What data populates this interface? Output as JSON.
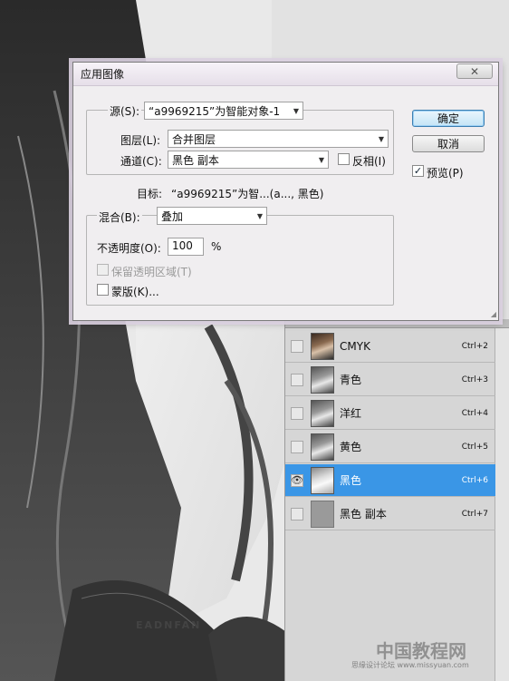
{
  "dialog": {
    "title": "应用图像",
    "source_label": "源(S):",
    "source_value": "“a9969215”为智能对象-1",
    "layer_label": "图层(L):",
    "layer_value": "合并图层",
    "channel_label": "通道(C):",
    "channel_value": "黑色 副本",
    "invert_label": "反相(I)",
    "target_label": "目标:",
    "target_value": "“a9969215”为智...(a..., 黑色)",
    "blending_label": "混合(B):",
    "blending_value": "叠加",
    "opacity_label": "不透明度(O):",
    "opacity_value": "100",
    "opacity_unit": "%",
    "preserve_transparency_label": "保留透明区域(T)",
    "mask_label": "蒙版(K)...",
    "ok_label": "确定",
    "cancel_label": "取消",
    "preview_label": "预览(P)",
    "close_glyph": "✕"
  },
  "channels_panel": {
    "channels": [
      {
        "name": "CMYK",
        "shortcut": "Ctrl+2",
        "visible": false
      },
      {
        "name": "青色",
        "shortcut": "Ctrl+3",
        "visible": false
      },
      {
        "name": "洋红",
        "shortcut": "Ctrl+4",
        "visible": false
      },
      {
        "name": "黄色",
        "shortcut": "Ctrl+5",
        "visible": false
      },
      {
        "name": "黑色",
        "shortcut": "Ctrl+6",
        "visible": true
      },
      {
        "name": "黑色 副本",
        "shortcut": "Ctrl+7",
        "visible": false
      }
    ],
    "eye_glyph": "👁"
  },
  "watermarks": {
    "left": "EADNFAN",
    "right": "中国教程网",
    "right_sub": "思缘设计论坛 www.missyuan.com"
  },
  "colors": {
    "selection": "#3a96e6",
    "dialog_bg": "#f0eef0"
  }
}
